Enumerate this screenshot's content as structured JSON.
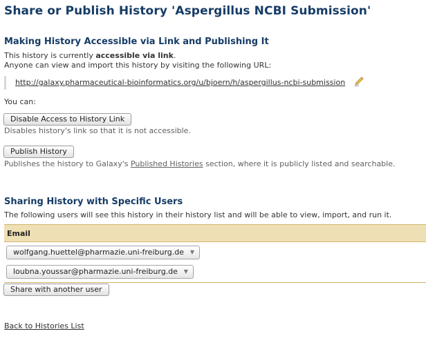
{
  "page_title": "Share or Publish History 'Aspergillus NCBI Submission'",
  "access_section": {
    "heading": "Making History Accessible via Link and Publishing It",
    "status_prefix": "This history is currently ",
    "status_bold": "accessible via link",
    "status_suffix": ".",
    "instructions": "Anyone can view and import this history by visiting the following URL:",
    "url": "http://galaxy.pharmaceutical-bioinformatics.org/u/bjoern/h/aspergillus-ncbi-submission",
    "edit_icon": "pencil-icon",
    "you_can": "You can:",
    "disable_button": "Disable Access to History Link",
    "disable_desc": "Disables history's link so that it is not accessible.",
    "publish_button": "Publish History",
    "publish_desc_prefix": "Publishes the history to Galaxy's ",
    "publish_desc_link": "Published Histories",
    "publish_desc_suffix": " section, where it is publicly listed and searchable."
  },
  "sharing_section": {
    "heading": "Sharing History with Specific Users",
    "description": "The following users will see this history in their history list and will be able to view, import, and run it.",
    "column_header": "Email",
    "users": [
      "wolfgang.huettel@pharmazie.uni-freiburg.de",
      "loubna.youssar@pharmazie.uni-freiburg.de"
    ],
    "share_button": "Share with another user"
  },
  "back_link": "Back to Histories List",
  "colors": {
    "heading": "#163c66",
    "table_header_bg": "#efdfb4",
    "table_border": "#d2b46a"
  }
}
